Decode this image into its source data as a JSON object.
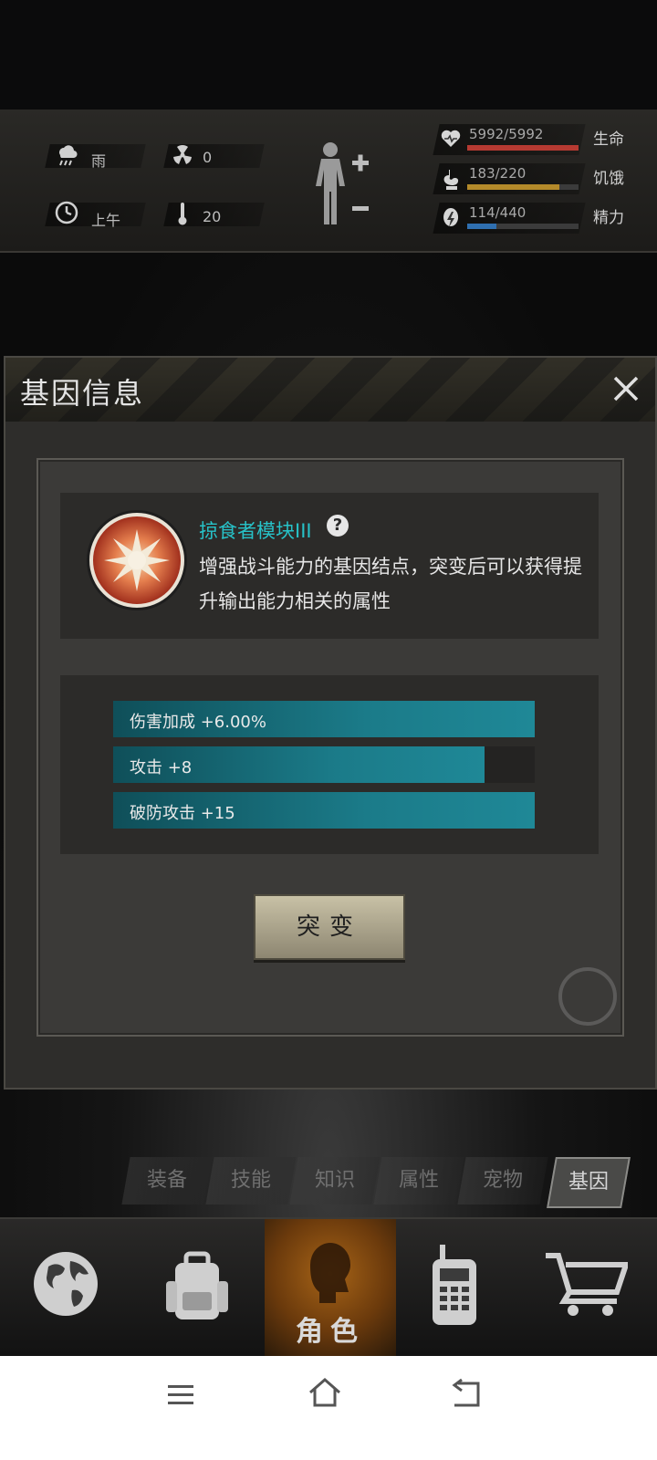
{
  "status": {
    "weather": "雨",
    "radiation": "0",
    "time_of_day": "上午",
    "temperature": "20",
    "gauges": [
      {
        "value": "5992/5992",
        "label": "生命",
        "fill": 1.0,
        "color": "#b63a32",
        "icon": "heart-icon"
      },
      {
        "value": "183/220",
        "label": "饥饿",
        "fill": 0.83,
        "color": "#b48a2a",
        "icon": "stomach-icon"
      },
      {
        "value": "114/440",
        "label": "精力",
        "fill": 0.26,
        "color": "#2f6fb0",
        "icon": "energy-icon"
      }
    ]
  },
  "dialog": {
    "title": "基因信息",
    "gene_name": "掠食者模块III",
    "description": "增强战斗能力的基因结点，突变后可以获得提升输出能力相关的属性",
    "attributes": [
      {
        "label": "伤害加成 +6.00%",
        "fill": 1.0
      },
      {
        "label": "攻击 +8",
        "fill": 0.88
      },
      {
        "label": "破防攻击 +15",
        "fill": 1.0
      }
    ],
    "mutate_button": "突变"
  },
  "tabs": [
    {
      "label": "装备",
      "active": false
    },
    {
      "label": "技能",
      "active": false
    },
    {
      "label": "知识",
      "active": false
    },
    {
      "label": "属性",
      "active": false
    },
    {
      "label": "宠物",
      "active": false
    },
    {
      "label": "基因",
      "active": true
    }
  ],
  "bottom_nav": [
    {
      "icon": "globe-icon",
      "label": ""
    },
    {
      "icon": "backpack-icon",
      "label": ""
    },
    {
      "icon": "character-icon",
      "label": "角色",
      "active": true
    },
    {
      "icon": "radio-icon",
      "label": ""
    },
    {
      "icon": "cart-icon",
      "label": ""
    }
  ]
}
